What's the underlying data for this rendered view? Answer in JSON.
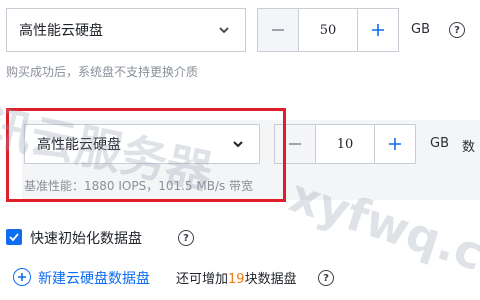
{
  "row1": {
    "disk_type": "高性能云硬盘",
    "size_value": "50",
    "unit": "GB",
    "help_icon": "question-circle-icon",
    "hint": "购买成功后，系统盘不支持更换介质"
  },
  "row2": {
    "disk_type": "高性能云硬盘",
    "size_value": "10",
    "unit": "GB",
    "trailing_text": "数",
    "perf_hint": "基准性能：1880 IOPS，101.5 MB/s 带宽"
  },
  "watermark": {
    "text_cn": "讯云服务器",
    "text_en": "xyfwq.c"
  },
  "quick_init": {
    "checked": true,
    "label": "快速初始化数据盘",
    "help_icon": "question-circle-icon"
  },
  "add_disk": {
    "icon": "plus-circle-icon",
    "link": "新建云硬盘数据盘",
    "extra_prefix": "还可增加",
    "extra_count": "19",
    "extra_suffix": "块数据盘",
    "help_icon": "question-circle-icon"
  },
  "colors": {
    "accent": "#0e6df2",
    "highlight_frame": "#e01e2b",
    "count_orange": "#f07b0f"
  }
}
